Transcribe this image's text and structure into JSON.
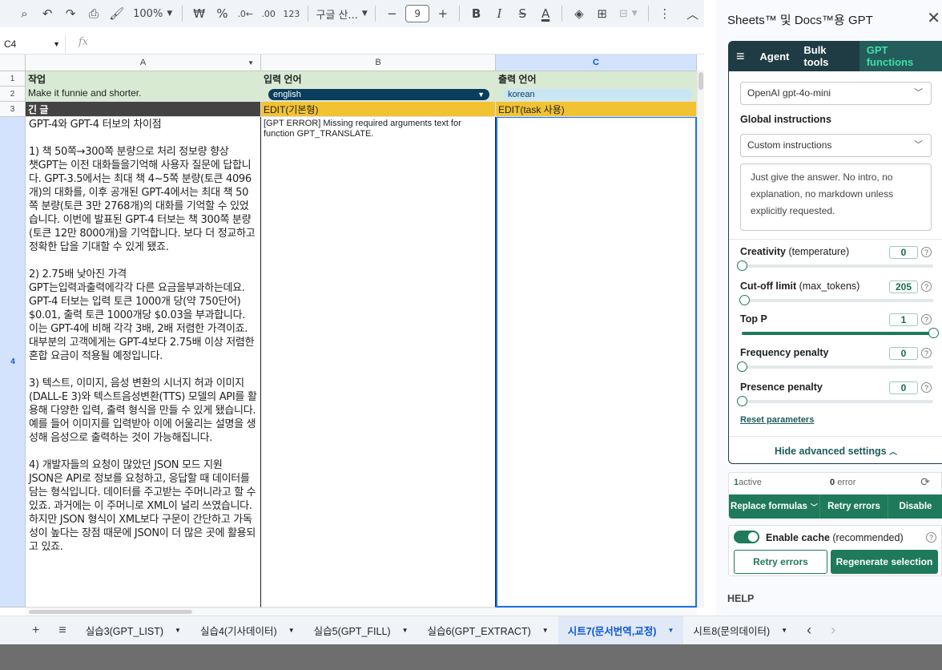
{
  "toolbar": {
    "zoom": "100%",
    "currency": "₩",
    "percent": "%",
    "dec_decrease": ".0←",
    "dec_increase": ".00",
    "number_format": "123",
    "font": "구글 산...",
    "font_size": "9",
    "minus": "−",
    "plus": "+"
  },
  "formula_bar": {
    "cell_ref": "C4",
    "fx": "fx"
  },
  "grid": {
    "columns": [
      "A",
      "B",
      "C"
    ],
    "rows": [
      "1",
      "2",
      "3",
      "4"
    ],
    "row1": {
      "a": "작업",
      "b": "입력 언어",
      "c": "출력 언어"
    },
    "row2": {
      "a": "Make it funnie and shorter.",
      "b": "english",
      "c": "korean"
    },
    "row3": {
      "a": "긴 글",
      "b": "EDIT(기본형)",
      "c": "EDIT(task 사용)"
    },
    "row4": {
      "a": "GPT-4와 GPT-4 터보의 차이점\n\n1) 책 50쪽→300쪽 분량으로 처리 정보량 향상\n챗GPT는 이전 대화들을기억해 사용자 질문에 답합니다. GPT-3.5에서는 최대 책 4~5쪽 분량(토큰 4096개)의 대화를, 이후 공개된 GPT-4에서는 최대 책 50쪽 분량(토큰 3만 2768개)의 대화를 기억할 수 있었습니다. 이번에 발표된 GPT-4 터보는 책 300쪽 분량(토큰 12만 8000개)을 기억합니다. 보다 더 정교하고 정확한 답을 기대할 수 있게 됐죠.\n\n2) 2.75배 낮아진 가격\nGPT는입력과출력에각각 다른 요금을부과하는데요. GPT-4 터보는 입력 토큰 1000개 당(약 750단어) $0.01, 출력 토큰 1000개당 $0.03을 부과합니다. 이는 GPT-4에 비해 각각 3배, 2배 저렴한 가격이죠. 대부분의 고객에게는 GPT-4보다 2.75배 이상 저렴한 혼합 요금이 적용될 예정입니다.\n\n3) 텍스트, 이미지, 음성 변환의 시너지 허과 이미지(DALL-E 3)와 텍스트음성변환(TTS) 모델의 API를 활용해 다양한 입력, 출력 형식을 만들 수 있게 됐습니다. 예를 들어 이미지를 입력받아 이에 어울리는 설명을 생성해 음성으로 출력하는 것이 가능해집니다.\n\n4) 개발자들의 요청이 많았던 JSON 모드 지원\nJSON은 API로 정보를 요청하고, 응답할 때 데이터를 담는 형식입니다. 데이터를 주고받는 주머니라고 할 수 있죠. 과거에는 이 주머니로 XML이 널리 쓰였습니다. 하지만 JSON 형식이 XML보다 구문이 간단하고 가독성이 높다는 장점 때문에 JSON이 더 많은 곳에 활용되고 있죠.",
      "b": "[GPT ERROR] Missing required arguments text for function GPT_TRANSLATE.",
      "c": ""
    }
  },
  "sheets": {
    "add": "+",
    "list": "≡",
    "tabs": [
      "실습3(GPT_LIST)",
      "실습4(기사데이터)",
      "실습5(GPT_FILL)",
      "실습6(GPT_EXTRACT)",
      "시트7(문서번역,교정)",
      "시트8(문의데이터)"
    ],
    "prev": "‹",
    "next": "›"
  },
  "panel": {
    "title": "Sheets™ 및 Docs™용 GPT",
    "close": "✕",
    "tabs": [
      "Agent",
      "Bulk tools",
      "GPT functions"
    ],
    "model": "OpenAI gpt-4o-mini",
    "global_instructions_label": "Global instructions",
    "instructions_select": "Custom instructions",
    "instructions_text": "Just give the answer. No intro, no explanation, no markdown unless explicitly requested.",
    "params": [
      {
        "name": "Creativity",
        "sub": " (temperature)",
        "value": "0",
        "fraction": 0
      },
      {
        "name": "Cut-off limit",
        "sub": " (max_tokens)",
        "value": "205",
        "fraction": 0.013
      },
      {
        "name": "Top P",
        "sub": "",
        "value": "1",
        "fraction": 1
      },
      {
        "name": "Frequency penalty",
        "sub": "",
        "value": "0",
        "fraction": 0
      },
      {
        "name": "Presence penalty",
        "sub": "",
        "value": "0",
        "fraction": 0
      }
    ],
    "reset": "Reset parameters",
    "hide_advanced": "Hide advanced settings",
    "active_count": "1",
    "active_label": "active",
    "error_count": "0",
    "error_label": "error",
    "replace_formulas": "Replace formulas",
    "retry_errors": "Retry errors",
    "disable": "Disable",
    "enable_cache": "Enable cache",
    "recommended": " (recommended)",
    "retry_errors_2": "Retry errors",
    "regenerate": "Regenerate selection",
    "help": "HELP"
  }
}
